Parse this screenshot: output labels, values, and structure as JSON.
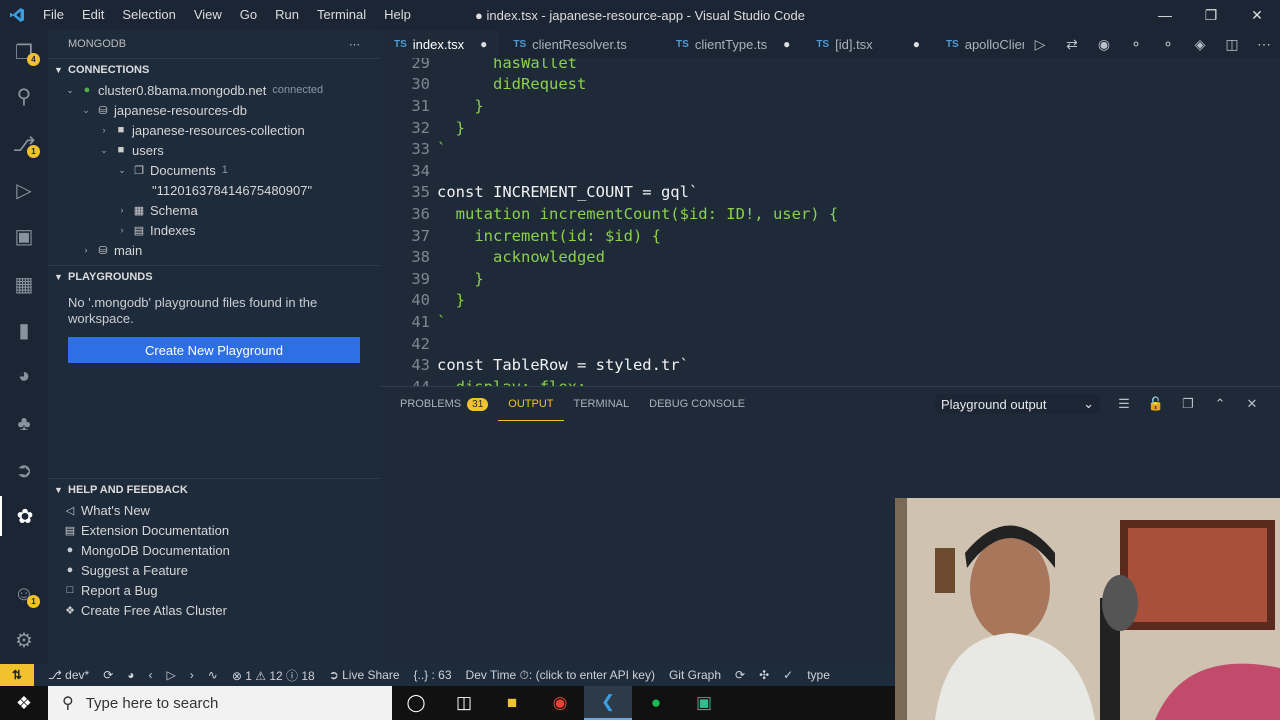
{
  "window": {
    "title": "● index.tsx - japanese-resource-app - Visual Studio Code",
    "menu": [
      "File",
      "Edit",
      "Selection",
      "View",
      "Go",
      "Run",
      "Terminal",
      "Help"
    ]
  },
  "activity": {
    "badges": {
      "explorer": "4",
      "scm": "1",
      "account": "1"
    }
  },
  "sidebar": {
    "title": "MONGODB",
    "connections_header": "CONNECTIONS",
    "cluster": "cluster0.8bama.mongodb.net",
    "cluster_status": "connected",
    "db": "japanese-resources-db",
    "collection": "japanese-resources-collection",
    "users": "users",
    "documents": "Documents",
    "documents_count": "1",
    "doc_id": "\"112016378414675480907\"",
    "schema": "Schema",
    "indexes": "Indexes",
    "main": "main",
    "playgrounds_header": "PLAYGROUNDS",
    "playground_msg": "No '.mongodb' playground files found in the workspace.",
    "create_btn": "Create New Playground",
    "help_header": "HELP AND FEEDBACK",
    "help_items": [
      "What's New",
      "Extension Documentation",
      "MongoDB Documentation",
      "Suggest a Feature",
      "Report a Bug",
      "Create Free Atlas Cluster"
    ]
  },
  "tabs": [
    {
      "label": "index.tsx",
      "modified": true,
      "active": true
    },
    {
      "label": "clientResolver.ts",
      "modified": false,
      "active": false
    },
    {
      "label": "clientType.ts",
      "modified": true,
      "active": false
    },
    {
      "label": "[id].tsx",
      "modified": true,
      "active": false
    },
    {
      "label": "apolloClient.t",
      "modified": false,
      "active": false
    }
  ],
  "editor": {
    "lines": [
      {
        "n": "29",
        "text": "      hasWallet"
      },
      {
        "n": "30",
        "text": "      didRequest"
      },
      {
        "n": "31",
        "text": "    }"
      },
      {
        "n": "32",
        "text": "  }"
      },
      {
        "n": "33",
        "text": "`"
      },
      {
        "n": "34",
        "text": ""
      },
      {
        "n": "35",
        "text": "const INCREMENT_COUNT = gql`"
      },
      {
        "n": "36",
        "text": "  mutation incrementCount($id: ID!, user) {"
      },
      {
        "n": "37",
        "text": "    increment(id: $id) {"
      },
      {
        "n": "38",
        "text": "      acknowledged"
      },
      {
        "n": "39",
        "text": "    }"
      },
      {
        "n": "40",
        "text": "  }"
      },
      {
        "n": "41",
        "text": "`"
      },
      {
        "n": "42",
        "text": ""
      },
      {
        "n": "43",
        "text": "const TableRow = styled.tr`"
      },
      {
        "n": "44",
        "text": "  display: flex;"
      }
    ]
  },
  "panel": {
    "tabs": [
      "PROBLEMS",
      "OUTPUT",
      "TERMINAL",
      "DEBUG CONSOLE"
    ],
    "problems_count": "31",
    "output_select": "Playground output"
  },
  "statusbar": {
    "branch": "dev*",
    "errors": "1",
    "warnings": "12",
    "infos": "18",
    "live_share": "Live Share",
    "braces": "{..} : 63",
    "dev_time": "Dev Time ⏱: (click to enter API key)",
    "git_graph": "Git Graph",
    "lang": "type"
  },
  "taskbar": {
    "search_placeholder": "Type here to search"
  }
}
